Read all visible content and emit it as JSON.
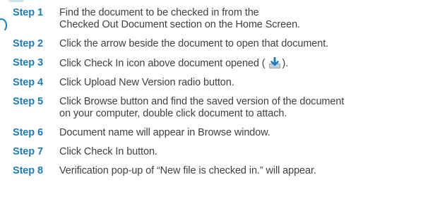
{
  "steps": [
    {
      "label": "Step 1",
      "lines": [
        "Find the document to be checked in from the",
        "Checked Out Document section on the Home Screen."
      ]
    },
    {
      "label": "Step 2",
      "lines": [
        "Click the arrow beside the document to open that document."
      ]
    },
    {
      "label": "Step 3",
      "text_before_icon": "Click Check In icon above document opened (",
      "icon": "check-in-icon",
      "text_after_icon": ")."
    },
    {
      "label": "Step 4",
      "lines": [
        "Click Upload New Version radio button."
      ]
    },
    {
      "label": "Step 5",
      "lines": [
        "Click Browse button and find the saved version of the document",
        "on your computer, double click document to attach."
      ]
    },
    {
      "label": "Step 6",
      "lines": [
        "Document name will appear in Browse window."
      ]
    },
    {
      "label": "Step 7",
      "lines": [
        "Click Check In button."
      ]
    },
    {
      "label": "Step 8",
      "lines": [
        "Verification pop-up of “New file is checked in.” will appear."
      ]
    }
  ],
  "colors": {
    "step_label": "#1a7bbf",
    "body_text": "#414042"
  }
}
